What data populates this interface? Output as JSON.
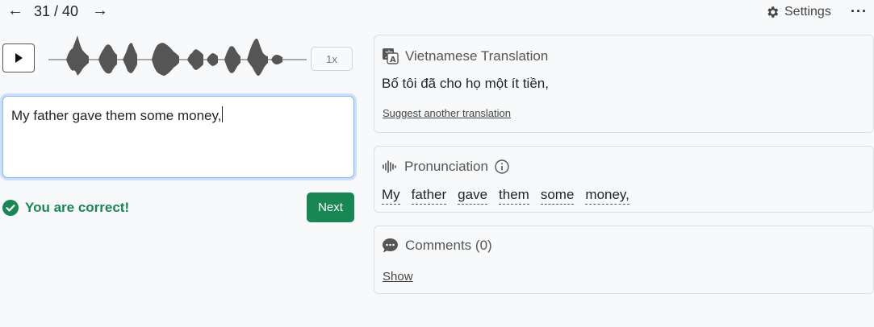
{
  "nav": {
    "prev_icon": "arrow-left-icon",
    "next_icon": "arrow-right-icon",
    "counter": "31 / 40",
    "settings_label": "Settings",
    "more_icon": "more-horizontal-icon"
  },
  "player": {
    "play_icon": "play-icon",
    "speed": "1x"
  },
  "answer": {
    "value": "My father gave them some money,"
  },
  "feedback": {
    "message": "You are correct!",
    "icon": "check-circle-icon",
    "color": "#198754"
  },
  "next_button": "Next",
  "translation_card": {
    "title": "Vietnamese Translation",
    "text": "Bố tôi đã cho họ một ít tiền,",
    "suggest_link": "Suggest another translation",
    "icon": "translate-icon"
  },
  "pronunciation_card": {
    "title": "Pronunciation",
    "icon": "audio-waveform-icon",
    "info_icon": "info-icon",
    "words": [
      "My",
      "father",
      "gave",
      "them",
      "some",
      "money,"
    ]
  },
  "comments_card": {
    "title": "Comments (0)",
    "icon": "comment-icon",
    "show_link": "Show"
  },
  "colors": {
    "accent_green": "#198754",
    "focus_border": "#86b7fe",
    "background": "#f8f9fa"
  }
}
